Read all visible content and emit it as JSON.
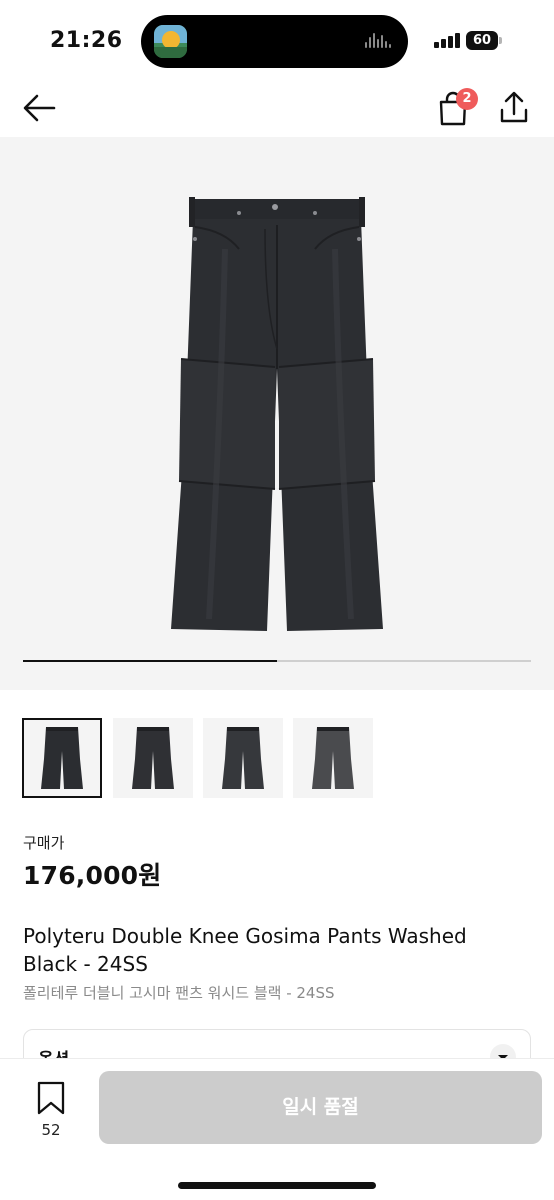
{
  "status_bar": {
    "time": "21:26",
    "battery": "60"
  },
  "nav": {
    "cart_count": "2"
  },
  "gallery": {
    "image_count": 4,
    "current_index": 1,
    "progress_fraction": 0.5
  },
  "thumbnails": [
    {
      "tone": "#2b2d31"
    },
    {
      "tone": "#2f3034"
    },
    {
      "tone": "#36383c"
    },
    {
      "tone": "#4a4b4e"
    }
  ],
  "price": {
    "label": "구매가",
    "value": "176,000원"
  },
  "product": {
    "name_en": "Polyteru Double Knee Gosima Pants Washed Black - 24SS",
    "name_ko": "폴리테루 더블니 고시마 팬츠 워시드 블랙 - 24SS"
  },
  "option": {
    "label": "옵션"
  },
  "bottom": {
    "bookmark_count": "52",
    "cta_label": "일시 품절"
  },
  "colors": {
    "accent_badge": "#ef5b5b",
    "disabled_button": "#cccccc",
    "garment": "#2b2d31"
  }
}
